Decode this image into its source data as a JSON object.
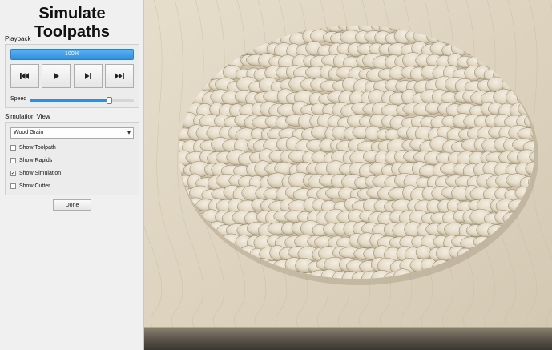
{
  "app": {
    "title": "Simulate Toolpaths"
  },
  "playback": {
    "section_label": "Playback",
    "progress_percent": 100,
    "progress_text": "100%",
    "buttons": [
      {
        "name": "rewind-button",
        "icon": "skip-to-start-icon"
      },
      {
        "name": "play-button",
        "icon": "play-icon"
      },
      {
        "name": "step-forward-button",
        "icon": "step-forward-icon"
      },
      {
        "name": "skip-to-end-button",
        "icon": "skip-to-end-icon"
      }
    ],
    "speed_label": "Speed",
    "speed_value": 0.76
  },
  "simulation_view": {
    "section_label": "Simulation View",
    "material": {
      "selected": "Wood Grain"
    },
    "options": [
      {
        "label": "Show Toolpath",
        "checked": false
      },
      {
        "label": "Show Rapids",
        "checked": false
      },
      {
        "label": "Show Simulation",
        "checked": true
      },
      {
        "label": "Show Cutter",
        "checked": false
      }
    ]
  },
  "done_label": "Done",
  "colors": {
    "accent": "#2f8fdd",
    "wood_base": "#ddd4c2",
    "carving_light": "#efe9dc",
    "carving_shadow": "#a89c84"
  }
}
